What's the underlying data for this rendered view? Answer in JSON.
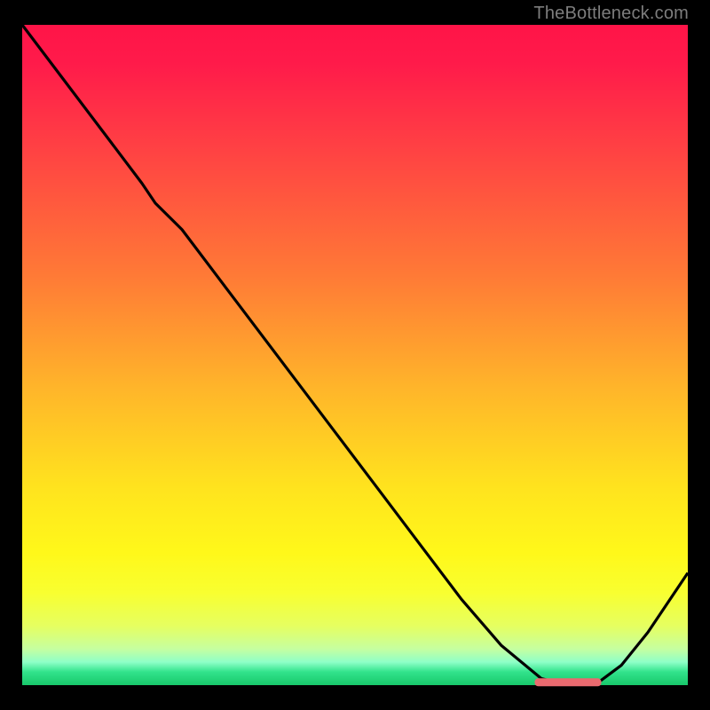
{
  "attribution": "TheBottleneck.com",
  "colors": {
    "gradient_top": "#ff1448",
    "gradient_mid1": "#ff7a36",
    "gradient_mid2": "#ffe31e",
    "gradient_bottom": "#18c86a",
    "curve": "#000000",
    "marker": "#e96a6f",
    "frame": "#000000"
  },
  "chart_data": {
    "type": "line",
    "title": "",
    "xlabel": "",
    "ylabel": "",
    "xlim": [
      0,
      100
    ],
    "ylim": [
      0,
      100
    ],
    "grid": false,
    "legend": false,
    "series": [
      {
        "name": "bottleneck-curve",
        "x": [
          0,
          6,
          12,
          18,
          20,
          24,
          30,
          36,
          42,
          48,
          54,
          60,
          66,
          72,
          78,
          82,
          86,
          90,
          94,
          100
        ],
        "y": [
          100,
          92,
          84,
          76,
          73,
          69,
          61,
          53,
          45,
          37,
          29,
          21,
          13,
          6,
          1,
          0,
          0,
          3,
          8,
          17
        ]
      }
    ],
    "marker": {
      "name": "optimal-range",
      "x_start": 77,
      "x_end": 87,
      "y": 0.5
    }
  }
}
